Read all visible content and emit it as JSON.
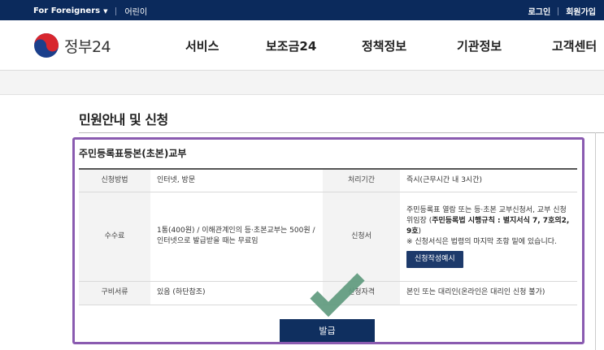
{
  "topbar": {
    "for_foreigners": "For Foreigners",
    "kids": "어린이",
    "login": "로그인",
    "signup": "회원가입"
  },
  "header": {
    "logo_text": "정부24",
    "menu": [
      "서비스",
      "보조금24",
      "정책정보",
      "기관정보",
      "고객센터"
    ]
  },
  "page": {
    "title": "민원안내 및 신청",
    "doc_title": "주민등록표등본(초본)교부"
  },
  "table": {
    "method_label": "신청방법",
    "method_value": "인터넷, 방문",
    "period_label": "처리기간",
    "period_value": "즉시(근무시간 내 3시간)",
    "fee_label": "수수료",
    "fee_value": "1통(400원) / 이해관계인의 등·초본교부는 500원 / 인터넷으로 발급받을 때는 무료임",
    "form_label": "신청서",
    "form_line1": "주민등록표 열람 또는 등·초본 교부신청서, 교부 신청 위임장 (",
    "form_bold": "주민등록법 시행규칙 : 별지서식 7, 7호의2, 9호",
    "form_line2": ")",
    "form_note": "※ 신청서식은 법령의 마지막 조항 밑에 있습니다.",
    "example_button": "신청작성예시",
    "docs_label": "구비서류",
    "docs_value": "있음 (하단참조)",
    "qual_label": "신청자격",
    "qual_value": "본인 또는 대리인(온라인은 대리인 신청 불가)"
  },
  "actions": {
    "issue_button": "발급"
  },
  "colors": {
    "topbar": "#0b2a5c",
    "highlight_frame": "#8a5bb0",
    "check": "#5f9a7e",
    "button": "#0f2f5f"
  }
}
